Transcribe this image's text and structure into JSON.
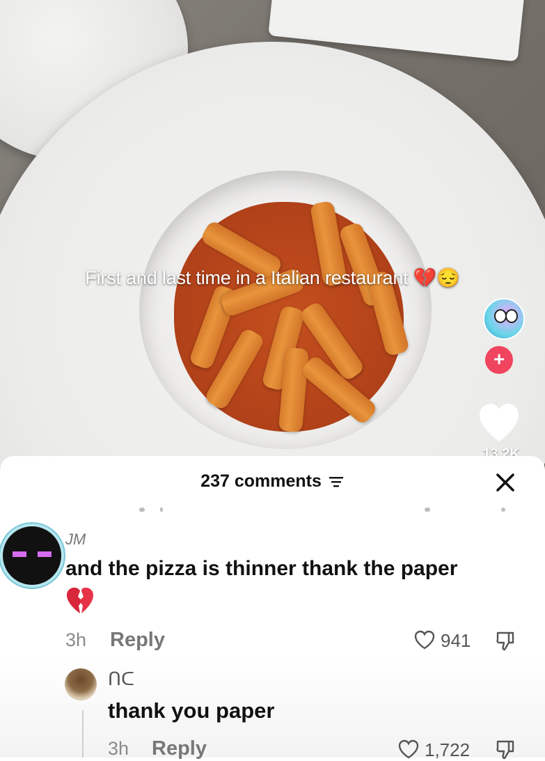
{
  "video": {
    "caption": "First and last time in a Italian restaurant",
    "caption_emoji": "💔😔",
    "like_count": "13.2K",
    "follow_symbol": "+"
  },
  "comments_sheet": {
    "title": "237 comments",
    "close_symbol": "✕"
  },
  "comments": [
    {
      "username": "JM",
      "text": "and the pizza is thinner thank the paper",
      "emoji": "💔",
      "time": "3h",
      "reply_label": "Reply",
      "likes": "941"
    },
    {
      "username": "ᑎᑕ",
      "text": "thank you paper",
      "time": "3h",
      "reply_label": "Reply",
      "likes": "1,722"
    }
  ],
  "colors": {
    "follow_badge": "#f0445f",
    "accent_ring": "#b5e6ef",
    "text_primary": "#111111",
    "text_secondary": "#8a8a8a"
  },
  "icons": [
    "filter-icon",
    "close-icon",
    "heart-icon",
    "outline-heart-icon",
    "dislike-icon",
    "plus-icon"
  ]
}
